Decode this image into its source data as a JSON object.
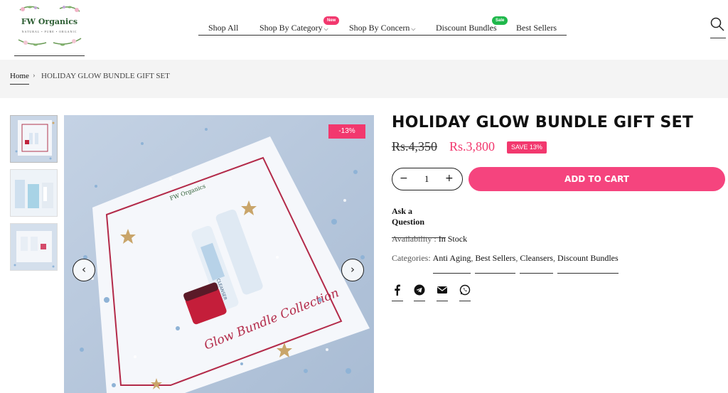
{
  "header": {
    "logo_text": "FW Organics",
    "logo_tagline": "NATURAL • PURE • ORGANIC",
    "nav": [
      {
        "label": "Shop All"
      },
      {
        "label": "Shop By Category",
        "badge": "New"
      },
      {
        "label": "Shop By Concern"
      },
      {
        "label": "Discount Bundles",
        "badge": "Sale"
      },
      {
        "label": "Best Sellers"
      }
    ]
  },
  "breadcrumb": {
    "home": "Home",
    "separator": "›",
    "current": "HOLIDAY GLOW BUNDLE GIFT SET"
  },
  "gallery": {
    "discount_badge": "-13%",
    "box_brand": "FW Organics",
    "box_script": "Glow Bundle Collection",
    "tube_label": "CLEANSER",
    "prev_icon": "‹",
    "next_icon": "›"
  },
  "product": {
    "title": "HOLIDAY GLOW BUNDLE GIFT SET",
    "price_old": "Rs.4,350",
    "price_new": "Rs.3,800",
    "save_label": "SAVE 13%",
    "qty_minus": "−",
    "qty_value": "1",
    "qty_plus": "+",
    "add_to_cart": "ADD TO CART",
    "ask_question": "Ask a Question",
    "availability_label": "Availability :",
    "availability_value": "In Stock",
    "categories_label": "Categories:",
    "categories": [
      "Anti Aging",
      "Best Sellers",
      "Cleansers",
      "Discount Bundles"
    ]
  },
  "colors": {
    "accent": "#f2386e",
    "sale_badge": "#1fb84b",
    "breadcrumb_bg": "#f4f4f4"
  },
  "icons": [
    "search-icon",
    "facebook-icon",
    "telegram-icon",
    "email-icon",
    "whatsapp-icon",
    "chevron-left-icon",
    "chevron-right-icon"
  ]
}
